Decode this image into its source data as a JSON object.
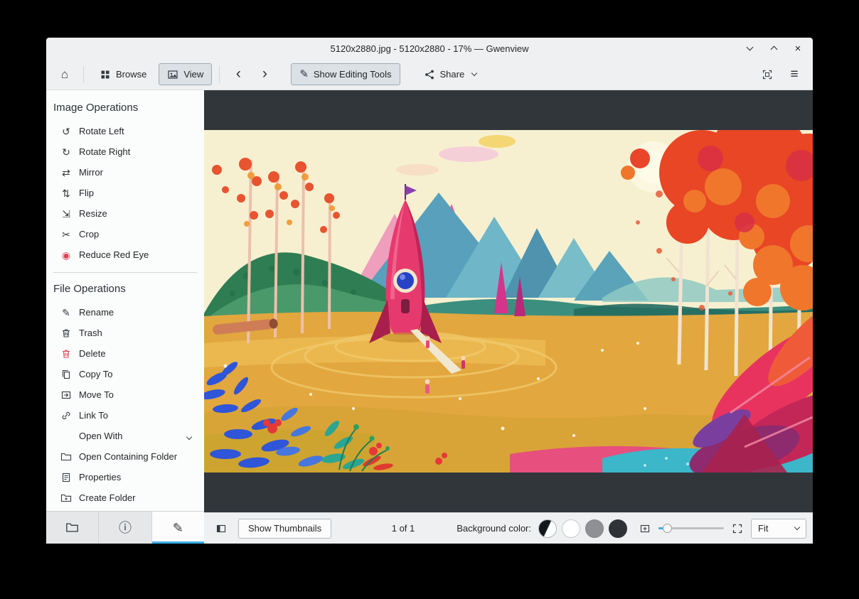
{
  "colors": {
    "accent": "#3daee9",
    "viewer_background": "#31363b",
    "danger": "#da4453"
  },
  "window": {
    "title": "5120x2880.jpg - 5120x2880 - 17% — Gwenview"
  },
  "toolbar": {
    "browse": "Browse",
    "view": "View",
    "show_editing_tools": "Show Editing Tools",
    "share": "Share"
  },
  "icons": {
    "home": "⌂",
    "back": "‹",
    "forward": "›",
    "menu": "≡",
    "close": "×",
    "rotate_left": "↺",
    "rotate_right": "↻",
    "mirror": "⇄",
    "flip": "⇅",
    "resize": "⇲",
    "crop": "✂",
    "reduce_red_eye": "◉",
    "pencil": "✎",
    "info": "ⓘ"
  },
  "sidebar": {
    "image_operations_title": "Image Operations",
    "image_operations": [
      {
        "label": "Rotate Left"
      },
      {
        "label": "Rotate Right"
      },
      {
        "label": "Mirror"
      },
      {
        "label": "Flip"
      },
      {
        "label": "Resize"
      },
      {
        "label": "Crop"
      },
      {
        "label": "Reduce Red Eye"
      }
    ],
    "file_operations_title": "File Operations",
    "file_operations": [
      {
        "label": "Rename"
      },
      {
        "label": "Trash"
      },
      {
        "label": "Delete"
      },
      {
        "label": "Copy To"
      },
      {
        "label": "Move To"
      },
      {
        "label": "Link To"
      },
      {
        "label": "Open With"
      },
      {
        "label": "Open Containing Folder"
      },
      {
        "label": "Properties"
      },
      {
        "label": "Create Folder"
      }
    ]
  },
  "statusbar": {
    "show_thumbnails": "Show Thumbnails",
    "page_indicator": "1 of 1",
    "background_color_label": "Background color:",
    "zoom_mode": "Fit",
    "background_swatches": [
      {
        "name": "auto",
        "value": "black/white split"
      },
      {
        "name": "white",
        "value": "#ffffff"
      },
      {
        "name": "gray",
        "value": "#8e9093"
      },
      {
        "name": "dark",
        "value": "#31363b"
      }
    ]
  }
}
